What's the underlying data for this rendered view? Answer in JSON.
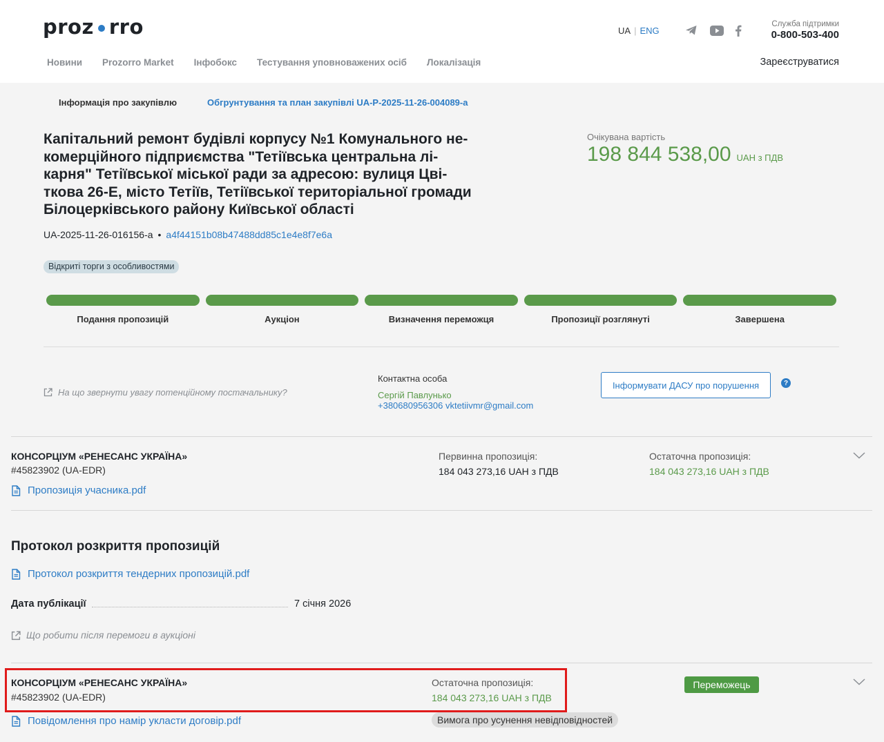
{
  "header": {
    "logo_left": "proz",
    "logo_right": "rro",
    "lang_ua": "UA",
    "lang_sep": "|",
    "lang_eng": "ENG",
    "support_label": "Служба підтримки",
    "support_phone": "0-800-503-400",
    "nav": [
      "Новини",
      "Prozorro Market",
      "Інфобокс",
      "Тестування уповноважених осіб",
      "Локалізація"
    ],
    "register": "Зареєструватися",
    "social_icons": [
      "telegram-icon",
      "youtube-icon",
      "facebook-icon"
    ]
  },
  "tabs": {
    "info": "Інформація про закупівлю",
    "plan": "Обгрунтування та план закупівлі UA-P-2025-11-26-004089-a"
  },
  "tender": {
    "title": "Капітальний ремонт будівлі корпусу №1 Комунального не-комерційного підприємства \"Тетіївська центральна лі-карня\" Тетіївської міської ради за адресою: вулиця Цві-ткова 26-Е, місто Тетіїв, Тетіївської територіальної громади Білоцерківського району Київської області",
    "title_lines": [
      "Капітальний ремонт будівлі корпусу №1 Комунального не-",
      "комерційного підприємства \"Тетіївська центральна лі-",
      "карня\" Тетіївської міської ради за адресою: вулиця Цві-",
      "ткова 26-Е, місто Тетіїв, Тетіївської територіальної громади",
      "Білоцерківського району Київської області"
    ],
    "expected_label": "Очікувана вартість",
    "expected_amount": "198 844 538,00",
    "expected_currency": "UAH з ПДВ",
    "id": "UA-2025-11-26-016156-a",
    "bullet": "•",
    "hash": "a4f44151b08b47488dd85c1e4e8f7e6a",
    "procedure_type": "Відкриті торги з особливостями"
  },
  "steps": [
    {
      "label": "Подання пропозицій",
      "complete": 1
    },
    {
      "label": "Аукціон",
      "complete": 1
    },
    {
      "label": "Визначення переможця",
      "complete": 1
    },
    {
      "label": "Пропозиції розглянуті",
      "complete": 1
    },
    {
      "label": "Завершена",
      "complete": 1
    }
  ],
  "notice": "На що звернути увагу потенційному постачальнику?",
  "contact": {
    "label": "Контактна особа",
    "name": "Сергій Павлунько",
    "phone_email": "+380680956306 vktetiivmr@gmail.com"
  },
  "dasu_button": "Інформувати ДАСУ про порушення",
  "help": "?",
  "bid": {
    "name": "КОНСОРЦІУМ «РЕНЕСАНС УКРАЇНА»",
    "edr": "#45823902 (UA-EDR)",
    "doc": "Пропозиція учасника.pdf",
    "initial_label": "Первинна пропозиція:",
    "initial_value": "184 043 273,16 UAH з ПДВ",
    "final_label": "Остаточна пропозиція:",
    "final_value": "184 043 273,16 UAH з ПДВ"
  },
  "protocol": {
    "title": "Протокол розкриття пропозицій",
    "doc": "Протокол розкриття тендерних пропозицій.pdf",
    "pub_label": "Дата публікації",
    "pub_value": "7 січня 2026",
    "after_win": "Що робити після перемоги в аукціоні"
  },
  "winner": {
    "name": "КОНСОРЦІУМ «РЕНЕСАНС УКРАЇНА»",
    "edr": "#45823902 (UA-EDR)",
    "final_label": "Остаточна пропозиція:",
    "final_value": "184 043 273,16 UAH з ПДВ",
    "badge": "Переможець",
    "doc": "Повідомлення про намір укласти договір.pdf",
    "claim": "Вимога про усунення невідповідностей"
  },
  "colors": {
    "accent": "#2d7cc5",
    "green": "#5a9a4a",
    "highlight": "#e01b1b"
  }
}
